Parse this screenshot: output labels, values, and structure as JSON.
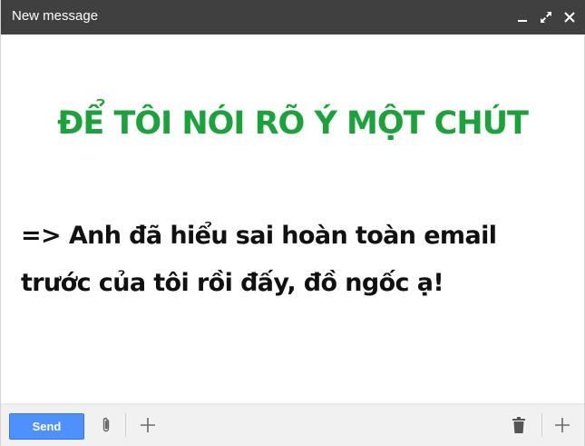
{
  "window": {
    "title": "New message",
    "controls": {
      "minimize_icon": "minimize-icon",
      "popout_icon": "expand-icon",
      "close_icon": "close-icon"
    }
  },
  "compose": {
    "headline": "ĐỂ TÔI NÓI RÕ Ý MỘT CHÚT",
    "message": "=> Anh đã hiểu sai hoàn toàn email trước của tôi rồi đấy, đồ ngốc ạ!"
  },
  "footer": {
    "send_label": "Send",
    "attach_icon": "paperclip-icon",
    "more_icon": "plus-icon",
    "delete_icon": "trash-icon",
    "more_options_icon": "plus-icon"
  },
  "colors": {
    "titlebar": "#404040",
    "headline": "#1aa33a",
    "send_button": "#4d90fe",
    "footer_bg": "#f1f1f1"
  }
}
